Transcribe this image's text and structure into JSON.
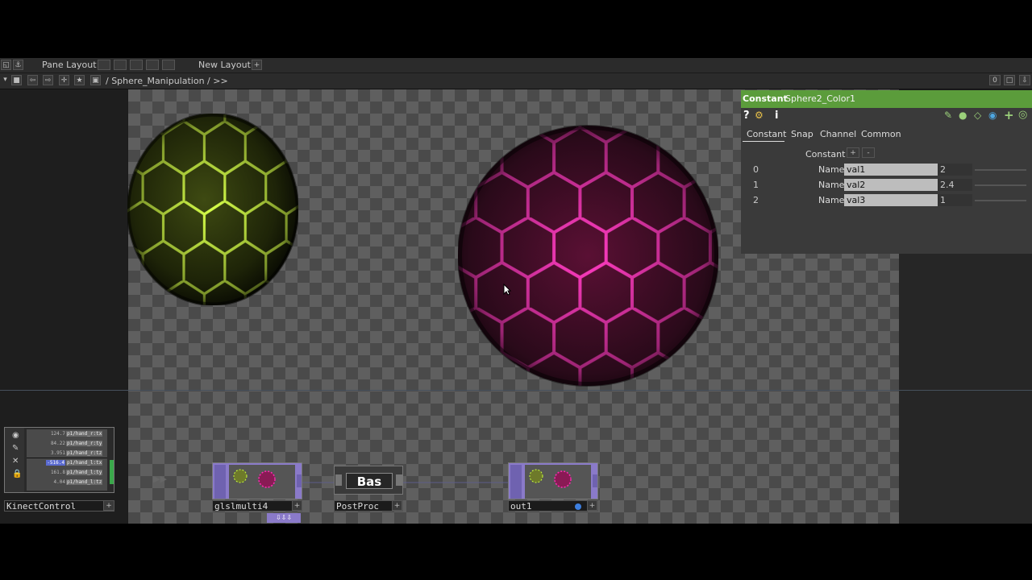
{
  "layout_bar": {
    "pane_layout": "Pane Layout",
    "new_layout": "New Layout",
    "add": "+"
  },
  "path_bar": {
    "path": "/ Sphere_Manipulation / >>",
    "counter": "0"
  },
  "params": {
    "op_type": "Constant",
    "op_name": "Sphere2_Color1",
    "tabs": [
      "Constant",
      "Snap",
      "Channel",
      "Common"
    ],
    "section_label": "Constant",
    "add": "+",
    "remove": "-",
    "rows": [
      {
        "index": "0",
        "label": "Name",
        "name": "val1",
        "value": "2"
      },
      {
        "index": "1",
        "label": "Name",
        "name": "val2",
        "value": "2.4"
      },
      {
        "index": "2",
        "label": "Name",
        "name": "val3",
        "value": "1"
      }
    ]
  },
  "kinect": {
    "label": "KinectControl",
    "rows": [
      {
        "value": "124.7",
        "channel": "p1/hand_r:tx"
      },
      {
        "value": "84.22",
        "channel": "p1/hand_r:ty"
      },
      {
        "value": "3.951",
        "channel": "p1/hand_r:tz"
      },
      {
        "value": "-516.4",
        "channel": "p1/hand_l:tx"
      },
      {
        "value": "161.8",
        "channel": "p1/hand_l:ty"
      },
      {
        "value": "4.04",
        "channel": "p1/hand_l:tz"
      }
    ]
  },
  "nodes": {
    "glsl": {
      "label": "glslmulti4"
    },
    "postproc": {
      "label": "PostProc",
      "viewer_text": "Bas"
    },
    "out": {
      "label": "out1"
    }
  },
  "colors": {
    "green_sphere": "#c8ff3c",
    "pink_sphere": "#ff2ab4",
    "title_bar": "#5b9c3b",
    "node_purple": "#8a7ac9"
  }
}
